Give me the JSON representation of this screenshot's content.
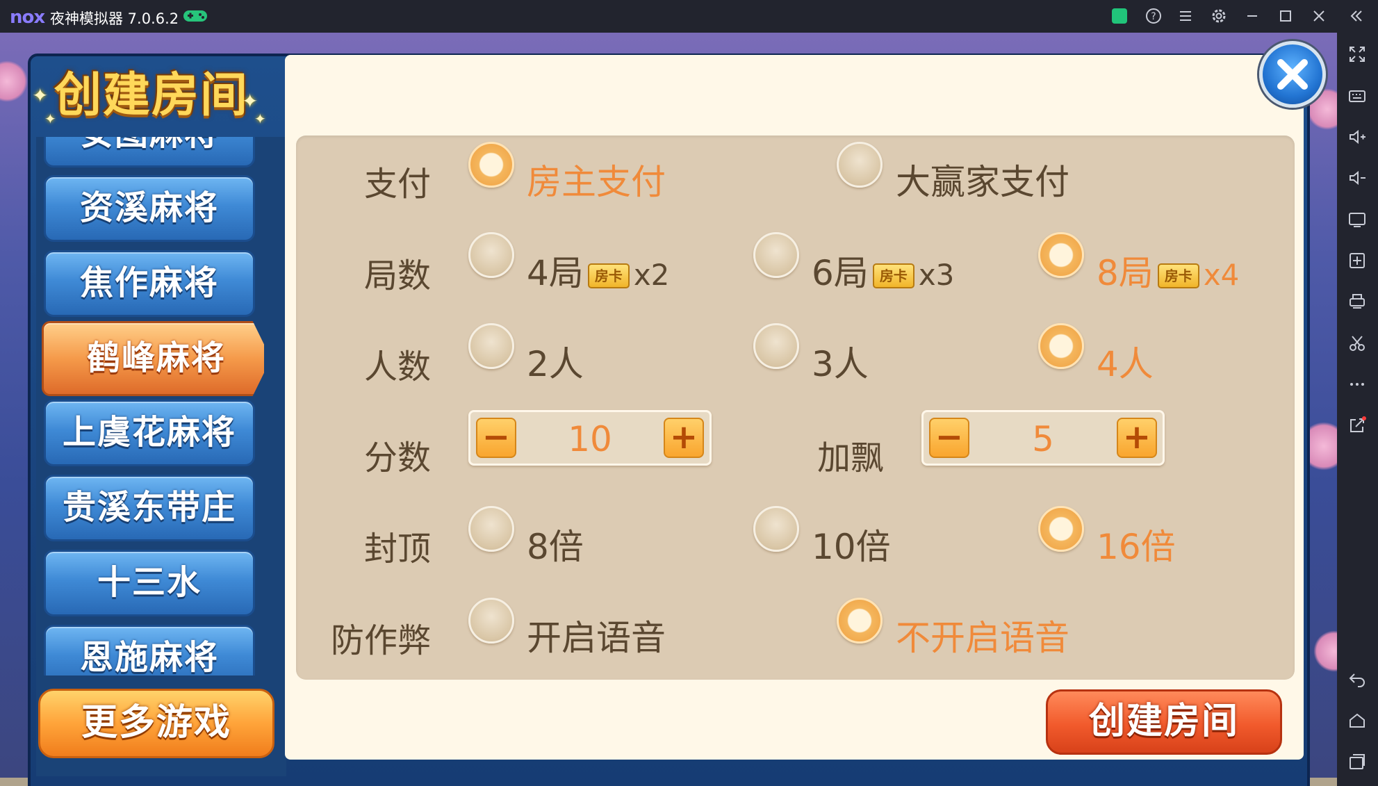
{
  "emulator": {
    "logo": "nox",
    "title": "夜神模拟器 7.0.6.2",
    "titlebar_icons": [
      "gamepad-icon",
      "bag-icon",
      "help-icon",
      "menu-icon",
      "settings-icon",
      "minimize-icon",
      "maximize-icon",
      "close-icon",
      "collapse-icon"
    ],
    "toolbar_icons": [
      "fullscreen-icon",
      "keyboard-icon",
      "volume-up-icon",
      "volume-down-icon",
      "screen-icon",
      "add-apk-icon",
      "print-icon",
      "scissors-icon",
      "more-icon",
      "share-icon",
      "back-icon",
      "home-icon",
      "recent-apps-icon"
    ]
  },
  "dialog": {
    "title": "创建房间",
    "games": [
      "安图麻将",
      "资溪麻将",
      "焦作麻将",
      "鹤峰麻将",
      "上虞花麻将",
      "贵溪东带庄",
      "十三水",
      "恩施麻将"
    ],
    "selected_game": "鹤峰麻将",
    "more_games_label": "更多游戏",
    "create_button_label": "创建房间",
    "rows": {
      "payment": {
        "label": "支付",
        "options": [
          "房主支付",
          "大赢家支付"
        ],
        "selected": "房主支付"
      },
      "rounds": {
        "label": "局数",
        "options": [
          {
            "text": "4局",
            "badge": "房卡",
            "mult": "x2"
          },
          {
            "text": "6局",
            "badge": "房卡",
            "mult": "x3"
          },
          {
            "text": "8局",
            "badge": "房卡",
            "mult": "x4"
          }
        ],
        "selected": "8局"
      },
      "players": {
        "label": "人数",
        "options": [
          "2人",
          "3人",
          "4人"
        ],
        "selected": "4人"
      },
      "score": {
        "label": "分数",
        "value": "10",
        "minus": "−",
        "plus": "+"
      },
      "bonus": {
        "label": "加飘",
        "value": "5",
        "minus": "−",
        "plus": "+"
      },
      "cap": {
        "label": "封顶",
        "options": [
          "8倍",
          "10倍",
          "16倍"
        ],
        "selected": "16倍"
      },
      "anticheat": {
        "label": "防作弊",
        "options": [
          "开启语音",
          "不开启语音"
        ],
        "selected": "不开启语音"
      }
    }
  },
  "colors": {
    "selected_text": "#f08a3a",
    "normal_text": "#5a4730",
    "panel_bg": "#dccbb3"
  }
}
